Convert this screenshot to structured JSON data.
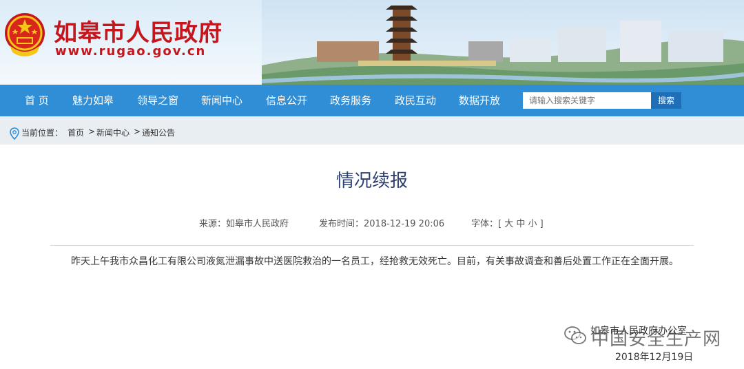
{
  "header": {
    "site_name": "如皋市人民政府",
    "site_url": "www.rugao.gov.cn"
  },
  "nav": {
    "items": [
      "首 页",
      "魅力如皋",
      "领导之窗",
      "新闻中心",
      "信息公开",
      "政务服务",
      "政民互动",
      "数据开放"
    ],
    "search_placeholder": "请输入搜索关键字",
    "search_button": "搜索"
  },
  "breadcrumb": {
    "prefix": "当前位置：",
    "items": [
      "首页",
      "新闻中心",
      "通知公告"
    ],
    "separator": ">"
  },
  "article": {
    "title": "情况续报",
    "source": "来源：如皋市人民政府",
    "publish_time": "发布时间：2018-12-19 20:06",
    "font_size_control": "字体：[ 大 中 小 ]",
    "body": "昨天上午我市众昌化工有限公司液氮泄漏事故中送医院救治的一名员工，经抢救无效死亡。目前，有关事故调查和善后处置工作正在全面开展。",
    "signature": "如皋市人民政府办公室",
    "date": "2018年12月19日"
  },
  "watermark": {
    "text": "中国安全生产网",
    "icon": "wechat-icon"
  },
  "colors": {
    "nav_bg": "#2f8ed6",
    "brand_red": "#c4161c",
    "title_blue": "#2c3e6e"
  }
}
